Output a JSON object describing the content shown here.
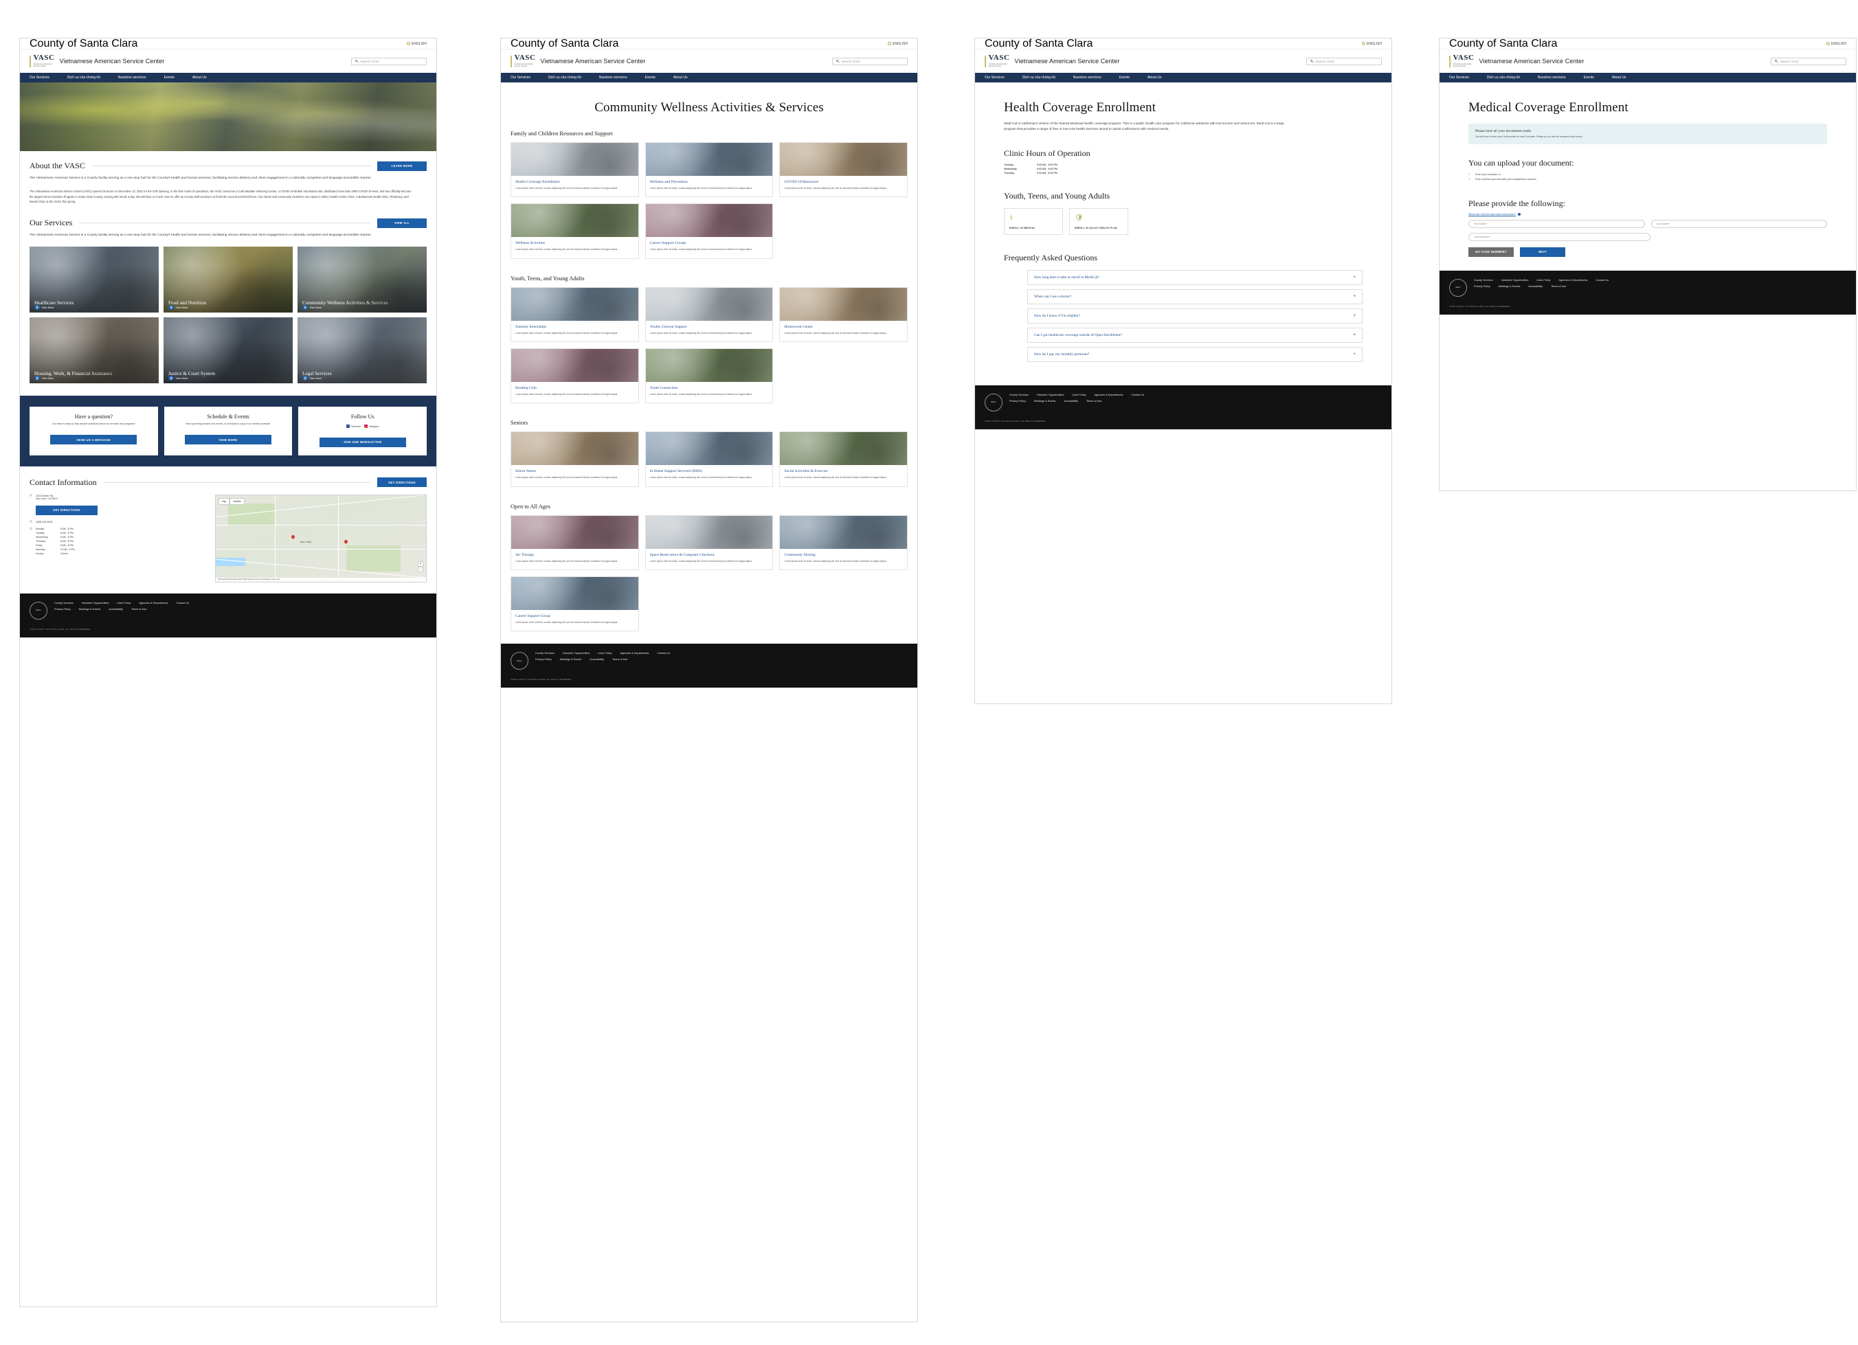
{
  "common": {
    "county_label": "County of Santa Clara",
    "language": "ENGLISH",
    "logo_abbr": "VASC",
    "logo_sub": "Vietnamese American\nService Center",
    "brand_name": "Vietnamese American Service Center",
    "search_placeholder": "Search VASC",
    "nav": [
      {
        "label": "Our Services"
      },
      {
        "label": "Dịch vụ của chúng tôi"
      },
      {
        "label": "Nuestros servicios"
      },
      {
        "label": "Events"
      },
      {
        "label": "About Us"
      }
    ],
    "footer": {
      "seal_text": "COUNTY OF SANTA CLARA",
      "links_row1": [
        "County Services",
        "Volunteer Opportunities",
        "Links Policy",
        "Agencies & Departments",
        "Contact Us"
      ],
      "links_row2": [
        "Privacy Policy",
        "Meetings & Events",
        "Accessibility",
        "Terms of Use"
      ],
      "copyright": "©2022 COUNTY OF SANTA CLARA, ALL RIGHTS RESERVED"
    }
  },
  "page1": {
    "about": {
      "heading": "About the VASC",
      "learn_more": "LEARN MORE",
      "lead": "The Vietnamese American Service is a County facility serving as a one-stop hub for the County's health and human services, facilitating service delivery and client engagement in a culturally competent and language-accessible manner.",
      "body": "The Vietnamese American Service Center (VASC) opened its doors on December 13, 2021 for the Soft Opening. In the first month of operations, the VASC served as a Cold Weather Warming Center, a COVID-19 Mobile Vaccination site, distributed more than 2000 COVID-19 tests, and has officially become the largest Senior Nutrition Program in Santa Clara County, serving 500 meals a day. We will have so much more to offer as County staff continues to finish the second and third floors. Our clients and community members can expect a Valley Health Center Clinic, a Behavioral Health Clinic, Pharmacy, and Dental Clinic at the VASC this spring."
    },
    "services": {
      "heading": "Our Services",
      "view_all": "VIEW ALL",
      "intro": "The Vietnamese American Service is a County facility serving as a one-stop hub for the County's health and human services, facilitating service delivery and client engagement in a culturally competent and language-accessible manner.",
      "view_more": "View More",
      "tiles": [
        {
          "title": "Healthcare Services"
        },
        {
          "title": "Food and Nutrition"
        },
        {
          "title": "Community Wellness Activities & Services"
        },
        {
          "title": "Housing, Work, & Financial Assistance"
        },
        {
          "title": "Justice & Court System"
        },
        {
          "title": "Legal Services"
        }
      ]
    },
    "cta": [
      {
        "title": "Have a question?",
        "text": "Our team is ready to help answer questions about our services and programs!",
        "button": "SEND US A MESSAGE"
      },
      {
        "title": "Schedule & Events",
        "text": "View upcoming classes and events, or download a copy of our weekly schedule.",
        "button": "VIEW MORE"
      },
      {
        "title": "Follow Us",
        "social": [
          "Facebook",
          "Instagram"
        ],
        "button": "JOIN OUR NEWSLETTER"
      }
    ],
    "contact": {
      "heading": "Contact Information",
      "directions_button": "GET DIRECTIONS",
      "address_line1": "2410 Senter Rd.",
      "address_line2": "San Jose, CA 95111",
      "map_directions_button": "GET DIRECTIONS",
      "phone": "(408) 518-5200",
      "hours": [
        {
          "day": "Monday",
          "time": "8 AM - 8 PM"
        },
        {
          "day": "Tuesday",
          "time": "8 AM - 8 PM"
        },
        {
          "day": "Wednesday",
          "time": "8 AM - 8 PM"
        },
        {
          "day": "Thursday",
          "time": "8 AM - 8 PM"
        },
        {
          "day": "Friday",
          "time": "8 AM - 8 PM"
        },
        {
          "day": "Saturday",
          "time": "10 AM - 5 PM"
        },
        {
          "day": "Sunday",
          "time": "Closed"
        }
      ],
      "map": {
        "tab_map": "Map",
        "tab_satellite": "Satellite",
        "city_label": "San Jose",
        "zoom_in": "+",
        "zoom_out": "−",
        "attribution": "Keyboard shortcuts   Map data ©2022 Google   Terms of Use   Report a map error"
      }
    }
  },
  "page2": {
    "title": "Community Wellness Activities & Services",
    "card_body": "Lorem ipsum dolor sit amet, conses adipiscing elit, sed do eiusmod tempor incididunt ut magna aliqua.",
    "sections": [
      {
        "heading": "Family and Children Resources and Support",
        "cards": [
          {
            "title": "Health Coverage Enrollment"
          },
          {
            "title": "Wellness and Prevention"
          },
          {
            "title": "COVID-19 Resources"
          },
          {
            "title": "Wellness Activities"
          },
          {
            "title": "Cancer Support Groups"
          }
        ]
      },
      {
        "heading": "Youth, Teens, and Young Adults",
        "cards": [
          {
            "title": "Summer Internships"
          },
          {
            "title": "Youths General Support"
          },
          {
            "title": "Homework Center"
          },
          {
            "title": "Reading Club"
          },
          {
            "title": "Youth Connection"
          }
        ]
      },
      {
        "heading": "Seniors",
        "cards": [
          {
            "title": "Senior Abuse"
          },
          {
            "title": "In Home Support Services (IHSS)"
          },
          {
            "title": "Social Activities & Exercise"
          }
        ]
      },
      {
        "heading": "Open to All Ages",
        "cards": [
          {
            "title": "Art Therapy"
          },
          {
            "title": "Space Reservation & Computer Checkout"
          },
          {
            "title": "Community Sharing"
          },
          {
            "title": "Cancer Support Group"
          }
        ]
      }
    ]
  },
  "page3": {
    "title": "Health Coverage Enrollment",
    "intro": "Medi-Cal is California's version of the federal Medicaid health coverage program. This is a public health care program for California residents with low income and resources. Medi-Cal is a large program that provides a range of free or low-cost health services aimed to assist Californians with medical needs.",
    "clinic_hours_heading": "Clinic Hours of Operation",
    "clinic_hours": [
      {
        "day": "Tuesday",
        "time": "9:00 AM - 5:00 PM"
      },
      {
        "day": "Wednesday",
        "time": "9:00 AM - 5:00 PM"
      },
      {
        "day": "Thursday",
        "time": "9:00 AM - 5:00 PM"
      }
    ],
    "youth_heading": "Youth, Teens, and Young Adults",
    "options": [
      {
        "label": "ENROLL IN MEDICAL",
        "icon": "medical-form-icon"
      },
      {
        "label": "ENROLL IN VALLEY HEALTH PLAN",
        "icon": "shield-health-icon"
      }
    ],
    "faq_heading": "Frequently Asked Questions",
    "faqs": [
      {
        "question": "How long does it take to enroll in MediCal?"
      },
      {
        "question": "When can I see a doctor?"
      },
      {
        "question": "How do I know if I'm eligible?"
      },
      {
        "question": "Can I get healthcare coverage outside of Open Enrollment?"
      },
      {
        "question": "How do I pay my monthly premium?"
      }
    ]
  },
  "page4": {
    "title": "Medical Coverage Enrollment",
    "notice": {
      "heading": "Please have all your documents ready.",
      "text": "You will have to start over if left inactive for over 5 minutes. Please do not use the browser's back button."
    },
    "upload_heading": "You can upload your document:",
    "upload_options": [
      "From your computer, or",
      "From a picture you took with your smartphone's camera"
    ],
    "form_heading": "Please provide the following:",
    "help_link": "Where can I find the case name and number?",
    "fields": [
      {
        "placeholder": "First Name",
        "required": true
      },
      {
        "placeholder": "Last Name",
        "required": true
      },
      {
        "placeholder": "Case Number",
        "required": true
      }
    ],
    "buttons": {
      "secondary": "NO CASE NUMBER?",
      "primary": "NEXT"
    }
  }
}
